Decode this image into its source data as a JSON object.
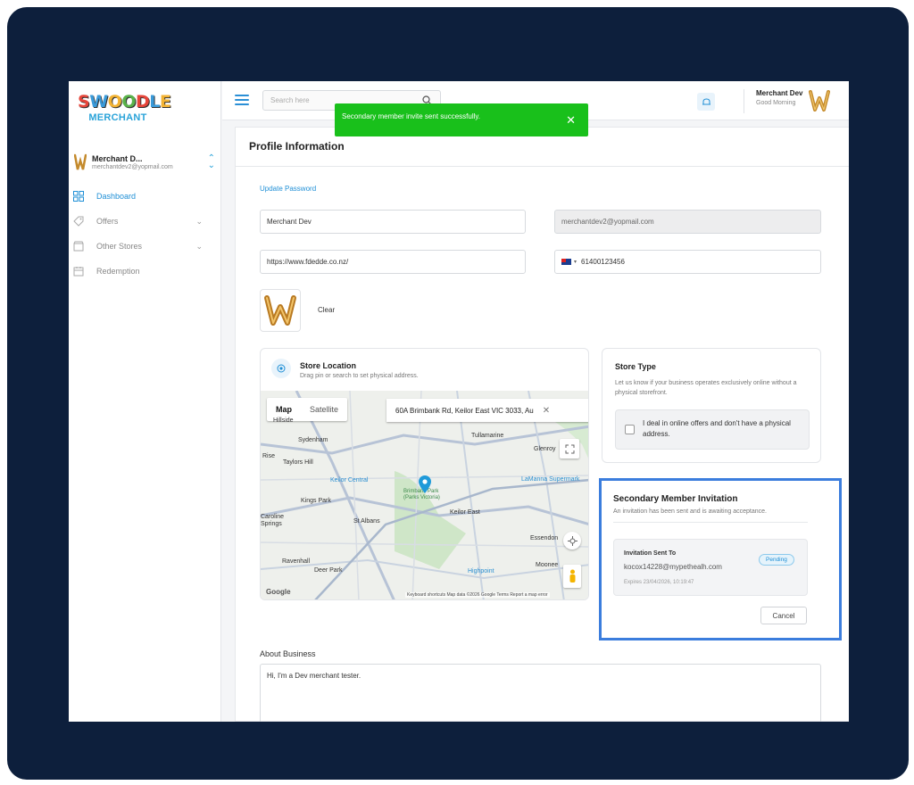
{
  "brand": {
    "logo_letters": [
      "S",
      "W",
      "O",
      "O",
      "D",
      "L",
      "E"
    ],
    "logo_colors": [
      "#e6453a",
      "#3a9ad9",
      "#f2b233",
      "#5ab24a",
      "#e6453a",
      "#3a9ad9",
      "#f2b233"
    ],
    "logo_sub": "MERCHANT"
  },
  "account": {
    "name": "Merchant D...",
    "email": "merchantdev2@yopmail.com"
  },
  "sidebar": {
    "items": [
      {
        "label": "Dashboard",
        "icon": "dashboard-icon"
      },
      {
        "label": "Offers",
        "icon": "tag-icon"
      },
      {
        "label": "Other Stores",
        "icon": "store-icon"
      },
      {
        "label": "Redemption",
        "icon": "calendar-icon"
      }
    ]
  },
  "topbar": {
    "search_placeholder": "Search here",
    "user_name": "Merchant Dev",
    "greeting": "Good Morning"
  },
  "toast": {
    "message": "Secondary member invite sent successfully.",
    "close": "✕"
  },
  "profile": {
    "title": "Profile Information",
    "update_password": "Update Password",
    "name": "Merchant Dev",
    "email": "merchantdev2@yopmail.com",
    "website": "https://www.fdedde.co.nz/",
    "phone": "61400123456",
    "clear": "Clear"
  },
  "store_location": {
    "title": "Store Location",
    "subtitle": "Drag pin or search to set physical address.",
    "map_tab": "Map",
    "satellite_tab": "Satellite",
    "address": "60A Brimbank Rd, Keilor East VIC 3033, Au",
    "labels": [
      "Hillside",
      "Sydenham",
      "Taylors Hill",
      "Rise",
      "Keilor Central",
      "Kings Park",
      "St Albans",
      "Caroline Springs",
      "Ravenhall",
      "Deer Park",
      "Tullamarine",
      "Glenroy",
      "Keilor East",
      "Essendon",
      "Moonee",
      "Brimbank Park (Parks Victoria)",
      "LaManna Supermark",
      "Highpoint"
    ],
    "attribution": "Keyboard shortcuts   Map data ©2026 Google   Terms   Report a map error",
    "google": "Google"
  },
  "store_type": {
    "title": "Store Type",
    "description": "Let us know if your business operates exclusively online without a physical storefront.",
    "checkbox_label": "I deal in online offers and don't have a physical address."
  },
  "invitation": {
    "title": "Secondary Member Invitation",
    "subtitle": "An invitation has been sent and is awaiting acceptance.",
    "sent_to_label": "Invitation Sent To",
    "email": "kocox14228@mypethealh.com",
    "status": "Pending",
    "expires": "Expires 23/04/2026, 10:19:47",
    "cancel": "Cancel"
  },
  "about": {
    "label": "About Business",
    "text": "Hi, I'm a Dev merchant tester."
  }
}
